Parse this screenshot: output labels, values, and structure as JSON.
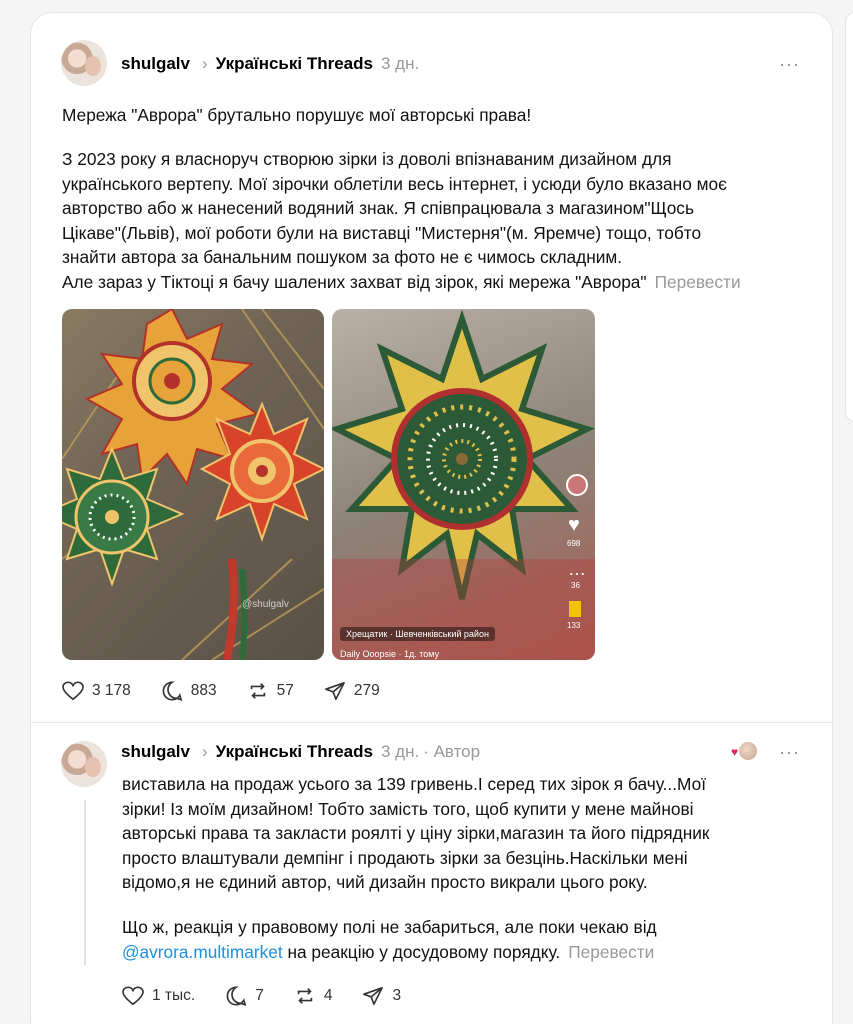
{
  "post1": {
    "username": "shulgalv",
    "community": "Українські Threads",
    "time": "3 дн.",
    "more_icon": "more-horizontal-icon",
    "lines": [
      "Мережа \"Аврора\" брутально порушує мої авторські права!",
      "З 2023 року я власноруч створюю зірки із доволі впізнаваним дизайном для",
      "українського вертепу. Мої зірочки облетіли весь інтернет, і усюди було вказано моє",
      "авторство або ж нанесений водяний знак. Я співпрацювала з магазином\"Щось",
      "Цікаве\"(Львів), мої роботи були на виставці \"Мистерня\"(м. Яремче) тощо, тобто",
      "знайти автора за банальним пошуком за фото не є чимось складним.",
      "Але зараз у Тіктоці я бачу шалених захват від зірок, які мережа \"Аврора\""
    ],
    "translate": "Перевести",
    "images": {
      "left_watermark": "@shulgalv",
      "right_location": "Хрещатик · Шевченківський район",
      "right_account": "Daily Ooopsie · 1д. тому",
      "right_likes": "698",
      "right_comments": "36",
      "right_saves": "133"
    },
    "stats": {
      "likes": "3 178",
      "comments": "883",
      "reposts": "57",
      "shares": "279"
    }
  },
  "post2": {
    "username": "shulgalv",
    "community": "Українські Threads",
    "time": "3 дн.",
    "author_label": "· Автор",
    "lines": [
      "виставила на продаж усього за 139 гривень.І серед тих зірок я бачу...Мої",
      "зірки! Із моїм дизайном! Тобто замість того, щоб купити у мене майнові",
      "авторські права та закласти роялті у ціну зірки,магазин та його підрядник",
      "просто влаштували демпінг і продають зірки за безцінь.Наскільки мені",
      "відомо,я не єдиний автор, чий дизайн просто викрали цього року."
    ],
    "line_last_pre": "Що ж, реакція у правовому полі не забариться, але поки чекаю від",
    "mention": "@avrora.multimarket",
    "line_last_post": " на реакцію у досудовому порядку.",
    "translate": "Перевести",
    "stats": {
      "likes": "1 тыс.",
      "comments": "7",
      "reposts": "4",
      "shares": "3"
    }
  },
  "colors": {
    "accent_link": "#1d8fe1",
    "muted": "#999999",
    "liked_red": "#e0245e"
  }
}
